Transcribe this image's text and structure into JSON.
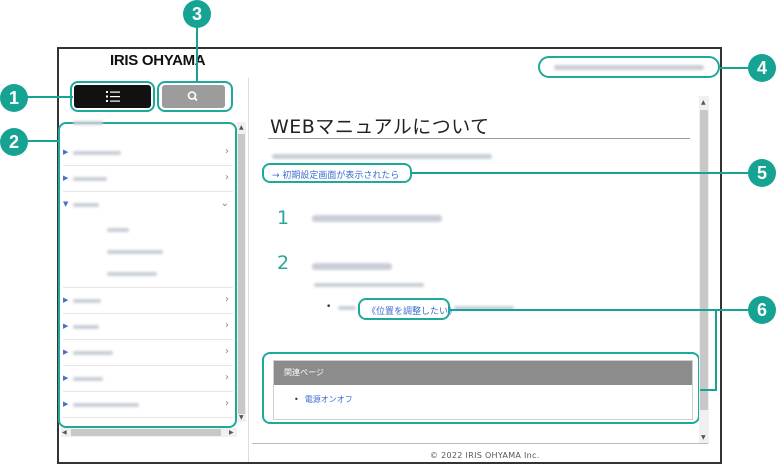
{
  "brand": {
    "logo_text": "IRIS OHYAMA"
  },
  "toolbar": {
    "list_icon": "list-icon",
    "search_icon": "search-icon"
  },
  "main": {
    "title": "WEBマニュアルについて",
    "init_link": "→ 初期設定画面が表示されたら",
    "steps": [
      {
        "number": "1"
      },
      {
        "number": "2"
      }
    ],
    "position_link": "《位置を調整したい》",
    "related": {
      "heading": "関連ページ",
      "links": [
        "電源オンオフ"
      ]
    }
  },
  "footer": {
    "copyright": "© 2022 IRIS OHYAMA Inc."
  },
  "callouts": [
    "1",
    "2",
    "3",
    "4",
    "5",
    "6"
  ],
  "colors": {
    "accent": "#17a394",
    "link": "#3b6bd0",
    "list_button": "#111111",
    "search_button": "#9c9c9c",
    "related_header": "#8c8c8c"
  }
}
